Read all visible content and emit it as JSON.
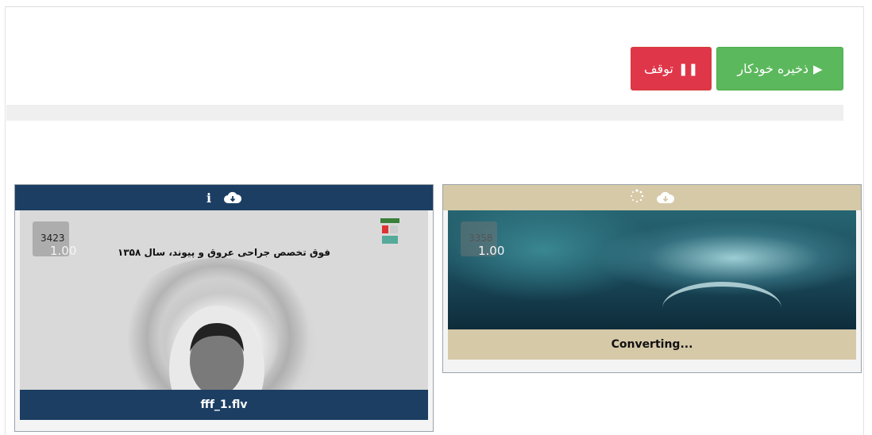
{
  "toolbar": {
    "auto_save_label": "ذخیره خودکار",
    "pause_label": "توقف",
    "auto_save_icon": "play-icon",
    "pause_icon": "pause-icon"
  },
  "progress": {
    "value": 0
  },
  "cards": [
    {
      "counter_number": "3423",
      "counter_value": "1.00",
      "thumbnail_caption": "فوق تخصص جراحی عروق و پیوند، سال ۱۳۵۸",
      "footer": "fff_1.flv",
      "header_icons": [
        "info-icon",
        "cloud-download-icon"
      ]
    },
    {
      "counter_number": "3358",
      "counter_value": "1.00",
      "footer": "Converting...",
      "header_icons": [
        "spinner-icon",
        "cloud-download-icon"
      ]
    }
  ],
  "colors": {
    "success": "#5cb85c",
    "danger": "#e0364a",
    "card_header_dark": "#1c3e63",
    "card_header_tan": "#d6c9a8"
  }
}
